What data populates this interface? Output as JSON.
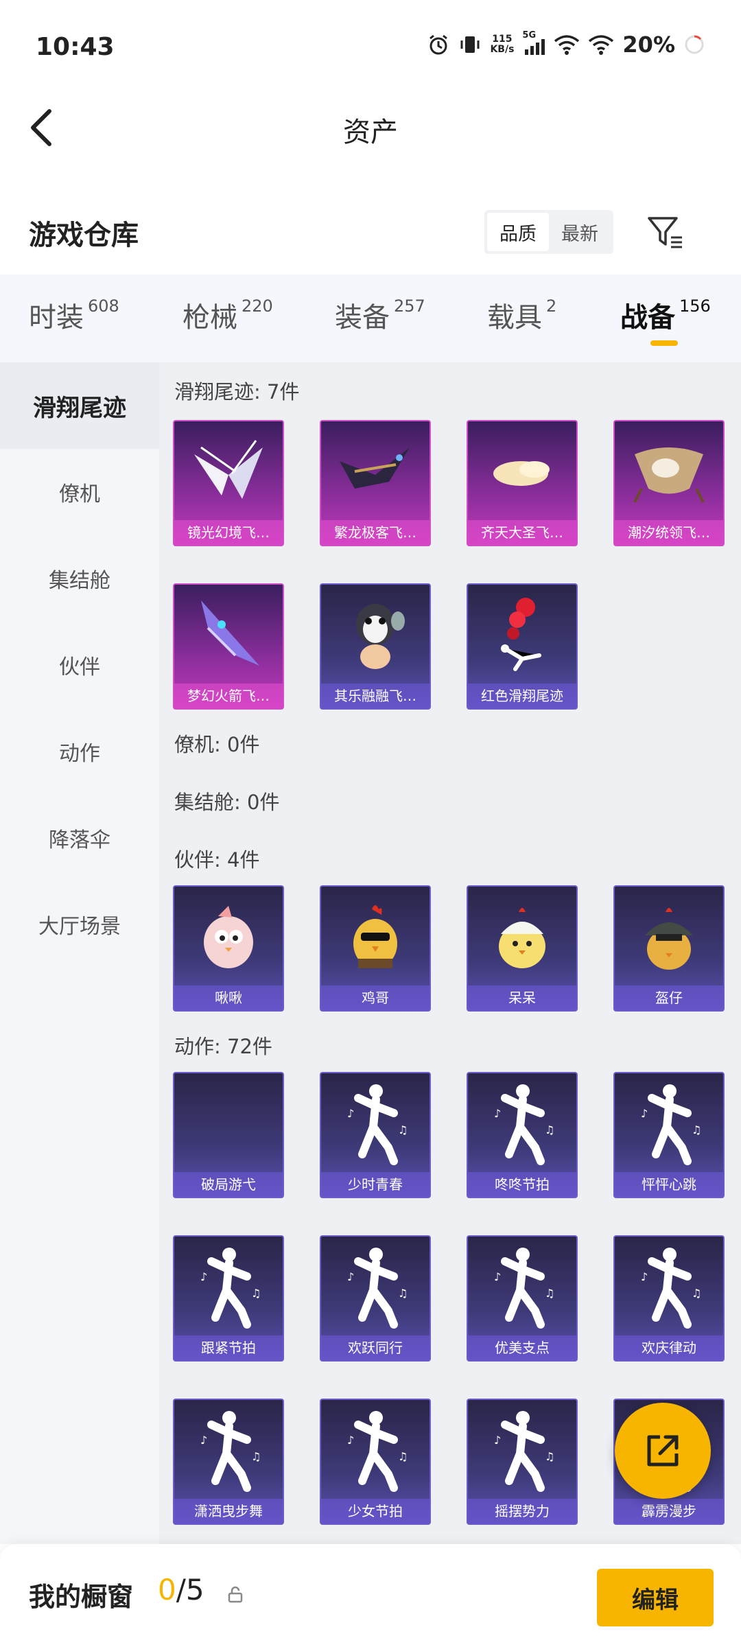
{
  "status": {
    "time": "10:43",
    "net_speed_value": "115",
    "net_speed_unit": "KB/s",
    "network_type": "5G",
    "battery": "20%"
  },
  "header": {
    "title": "资产"
  },
  "subheader": {
    "title": "游戏仓库",
    "sort_options": [
      "品质",
      "最新"
    ],
    "sort_selected": "品质"
  },
  "tabs": [
    {
      "label": "时装",
      "count": "608"
    },
    {
      "label": "枪械",
      "count": "220"
    },
    {
      "label": "装备",
      "count": "257"
    },
    {
      "label": "载具",
      "count": "2"
    },
    {
      "label": "战备",
      "count": "156",
      "active": true
    }
  ],
  "sidebar": [
    {
      "label": "滑翔尾迹",
      "active": true
    },
    {
      "label": "僚机"
    },
    {
      "label": "集结舱"
    },
    {
      "label": "伙伴"
    },
    {
      "label": "动作"
    },
    {
      "label": "降落伞"
    },
    {
      "label": "大厅场景"
    }
  ],
  "sections": {
    "glide_trail": {
      "title": "滑翔尾迹: 7件",
      "items": [
        {
          "name": "镜光幻境飞…",
          "quality": "pink",
          "icon": "wings-icon"
        },
        {
          "name": "繁龙极客飞…",
          "quality": "pink",
          "icon": "dragon-glider-icon"
        },
        {
          "name": "齐天大圣飞…",
          "quality": "pink",
          "icon": "cloud-icon"
        },
        {
          "name": "潮汐统领飞…",
          "quality": "pink",
          "icon": "ray-glider-icon"
        },
        {
          "name": "梦幻火箭飞…",
          "quality": "pink",
          "icon": "rocket-glider-icon"
        },
        {
          "name": "其乐融融飞…",
          "quality": "blue",
          "icon": "penguin-icon"
        },
        {
          "name": "红色滑翔尾迹",
          "quality": "blue",
          "icon": "red-smoke-icon"
        }
      ]
    },
    "wingman": {
      "title": "僚机: 0件"
    },
    "capsule": {
      "title": "集结舱: 0件"
    },
    "companion": {
      "title": "伙伴: 4件",
      "items": [
        {
          "name": "啾啾",
          "quality": "blue",
          "icon": "pink-bird-icon"
        },
        {
          "name": "鸡哥",
          "quality": "blue",
          "icon": "chicken-sunglasses-icon"
        },
        {
          "name": "呆呆",
          "quality": "blue",
          "icon": "chick-icon"
        },
        {
          "name": "盔仔",
          "quality": "blue",
          "icon": "helmet-chick-icon"
        }
      ]
    },
    "emote": {
      "title": "动作: 72件",
      "items": [
        {
          "name": "破局游弋",
          "quality": "blue",
          "icon": ""
        },
        {
          "name": "少时青春",
          "quality": "blue",
          "icon": "dance-icon"
        },
        {
          "name": "咚咚节拍",
          "quality": "blue",
          "icon": "dance-icon"
        },
        {
          "name": "怦怦心跳",
          "quality": "blue",
          "icon": "dance-icon"
        },
        {
          "name": "跟紧节拍",
          "quality": "blue",
          "icon": "dance-icon"
        },
        {
          "name": "欢跃同行",
          "quality": "blue",
          "icon": "dance-icon"
        },
        {
          "name": "优美支点",
          "quality": "blue",
          "icon": "dance-icon"
        },
        {
          "name": "欢庆律动",
          "quality": "blue",
          "icon": "dance-icon"
        },
        {
          "name": "潇洒曳步舞",
          "quality": "blue",
          "icon": "dance-icon"
        },
        {
          "name": "少女节拍",
          "quality": "blue",
          "icon": "dance-icon"
        },
        {
          "name": "摇摆势力",
          "quality": "blue",
          "icon": "dance-icon"
        },
        {
          "name": "霹雳漫步",
          "quality": "blue",
          "icon": "dance-icon"
        }
      ]
    }
  },
  "bottom": {
    "label": "我的橱窗",
    "current": "0",
    "separator": "/",
    "total": "5",
    "edit_label": "编辑"
  },
  "colors": {
    "accent": "#f7b500",
    "pink_quality": "#c438b8",
    "blue_quality": "#5a4fb0"
  }
}
